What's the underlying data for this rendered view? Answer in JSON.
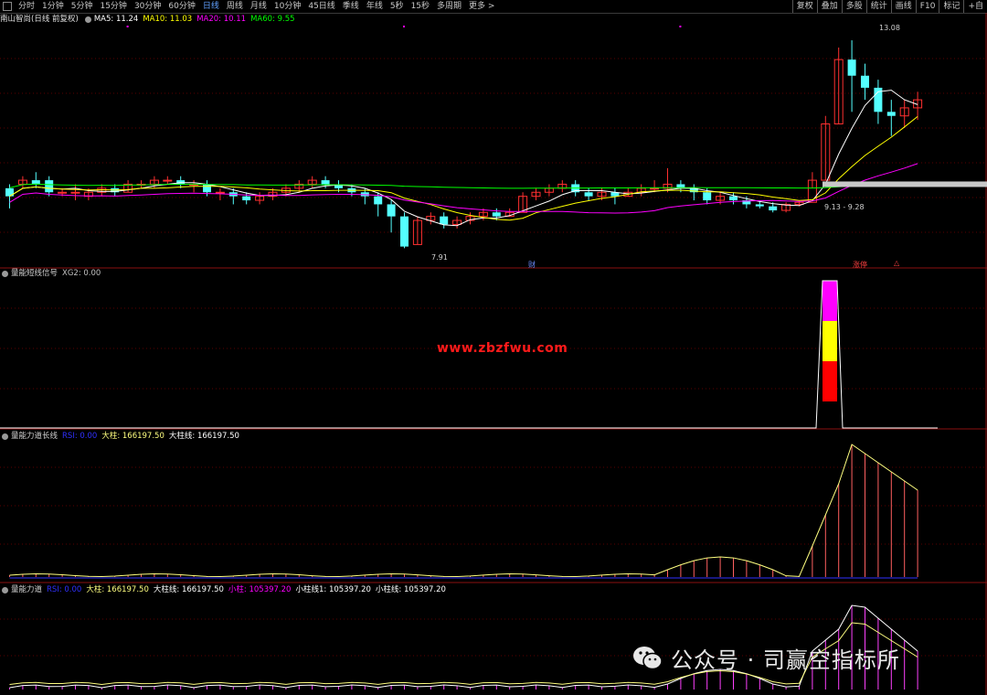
{
  "toolbar": {
    "tabs": [
      {
        "label": "分时"
      },
      {
        "label": "1分钟"
      },
      {
        "label": "5分钟"
      },
      {
        "label": "15分钟"
      },
      {
        "label": "30分钟"
      },
      {
        "label": "60分钟"
      },
      {
        "label": "日线",
        "active": true
      },
      {
        "label": "周线"
      },
      {
        "label": "月线"
      },
      {
        "label": "10分钟"
      },
      {
        "label": "45日线"
      },
      {
        "label": "季线"
      },
      {
        "label": "年线"
      },
      {
        "label": "5秒"
      },
      {
        "label": "15秒"
      },
      {
        "label": "多周期"
      },
      {
        "label": "更多 >"
      }
    ],
    "right_items": [
      {
        "label": "复权"
      },
      {
        "label": "叠加"
      },
      {
        "label": "多股"
      },
      {
        "label": "统计"
      },
      {
        "label": "画线"
      },
      {
        "label": "F10"
      },
      {
        "label": "标记"
      },
      {
        "label": "+自"
      }
    ]
  },
  "main_panel": {
    "stock_name": "南山智尚(日线 前复权)",
    "ma": [
      {
        "label": "MA5: 11.24",
        "color": "#ffffff"
      },
      {
        "label": "MA10: 11.03",
        "color": "#ffff00"
      },
      {
        "label": "MA20: 10.11",
        "color": "#ff00ff"
      },
      {
        "label": "MA60: 9.55",
        "color": "#00ff00"
      }
    ],
    "high_label": "13.08",
    "low_label": "7.91",
    "range_label": "9.13 - 9.28",
    "event_tags": [
      {
        "text": "财",
        "color": "#6b8cff"
      },
      {
        "text": "涨停",
        "color": "#ff4040"
      },
      {
        "text": "△",
        "color": "#ff4040"
      }
    ]
  },
  "panel2": {
    "title": "量能短线信号",
    "values": [
      {
        "label": "XG2: 0.00",
        "color": "#c0c0c0"
      }
    ]
  },
  "panel3": {
    "title": "量能力道长线",
    "values": [
      {
        "label": "RSI: 0.00",
        "color": "#3030ff"
      },
      {
        "label": "大柱: 166197.50",
        "color": "#ffff80"
      },
      {
        "label": "大柱线: 166197.50",
        "color": "#ffffff"
      }
    ]
  },
  "panel4": {
    "title": "量能力道",
    "values": [
      {
        "label": "RSI: 0.00",
        "color": "#3030ff"
      },
      {
        "label": "大柱: 166197.50",
        "color": "#ffff80"
      },
      {
        "label": "大柱线: 166197.50",
        "color": "#ffffff"
      },
      {
        "label": "小柱: 105397.20",
        "color": "#ff00ff"
      },
      {
        "label": "小柱线1: 105397.20",
        "color": "#ffffff"
      },
      {
        "label": "小柱线: 105397.20",
        "color": "#ffffff"
      }
    ]
  },
  "watermark": "www.zbzfwu.com",
  "wechat_caption": "公众号 · 司赢空指标所",
  "colors": {
    "up": "#ff3030",
    "down": "#54ffff",
    "grid": "#5a0000",
    "ma5": "#ffffff",
    "ma10": "#ffff00",
    "ma20": "#ff00ff",
    "ma60": "#00ff00"
  },
  "chart_data": {
    "type": "candlestick",
    "ylim": [
      7.6,
      13.4
    ],
    "candles": [
      [
        9.4,
        9.5,
        9.2,
        8.9
      ],
      [
        9.5,
        9.7,
        9.6,
        9.4
      ],
      [
        9.6,
        9.8,
        9.5,
        9.4
      ],
      [
        9.6,
        9.7,
        9.3,
        9.2
      ],
      [
        9.3,
        9.4,
        9.3,
        9.2
      ],
      [
        9.3,
        9.5,
        9.3,
        9.1
      ],
      [
        9.2,
        9.4,
        9.3,
        9.1
      ],
      [
        9.3,
        9.5,
        9.4,
        9.2
      ],
      [
        9.4,
        9.5,
        9.3,
        9.2
      ],
      [
        9.3,
        9.6,
        9.5,
        9.3
      ],
      [
        9.5,
        9.6,
        9.5,
        9.4
      ],
      [
        9.5,
        9.7,
        9.6,
        9.4
      ],
      [
        9.6,
        9.7,
        9.6,
        9.5
      ],
      [
        9.6,
        9.7,
        9.5,
        9.4
      ],
      [
        9.5,
        9.6,
        9.5,
        9.3
      ],
      [
        9.5,
        9.6,
        9.3,
        9.2
      ],
      [
        9.3,
        9.4,
        9.3,
        9.1
      ],
      [
        9.3,
        9.4,
        9.2,
        9.0
      ],
      [
        9.2,
        9.3,
        9.1,
        9.0
      ],
      [
        9.1,
        9.3,
        9.2,
        9.0
      ],
      [
        9.2,
        9.4,
        9.3,
        9.1
      ],
      [
        9.3,
        9.5,
        9.4,
        9.2
      ],
      [
        9.4,
        9.6,
        9.5,
        9.3
      ],
      [
        9.5,
        9.7,
        9.6,
        9.4
      ],
      [
        9.6,
        9.7,
        9.5,
        9.4
      ],
      [
        9.5,
        9.6,
        9.4,
        9.3
      ],
      [
        9.4,
        9.5,
        9.3,
        9.2
      ],
      [
        9.3,
        9.4,
        9.2,
        9.0
      ],
      [
        9.2,
        9.3,
        9.0,
        8.7
      ],
      [
        9.0,
        9.1,
        8.7,
        8.3
      ],
      [
        8.7,
        8.8,
        7.95,
        7.91
      ],
      [
        8.0,
        8.7,
        8.6,
        8.0
      ],
      [
        8.6,
        8.8,
        8.7,
        8.5
      ],
      [
        8.7,
        8.8,
        8.5,
        8.4
      ],
      [
        8.5,
        8.7,
        8.6,
        8.4
      ],
      [
        8.6,
        8.8,
        8.7,
        8.5
      ],
      [
        8.7,
        8.9,
        8.8,
        8.6
      ],
      [
        8.8,
        8.9,
        8.7,
        8.6
      ],
      [
        8.7,
        8.9,
        8.8,
        8.7
      ],
      [
        8.8,
        9.3,
        9.2,
        8.8
      ],
      [
        9.2,
        9.4,
        9.3,
        9.1
      ],
      [
        9.3,
        9.5,
        9.4,
        9.2
      ],
      [
        9.4,
        9.6,
        9.5,
        9.3
      ],
      [
        9.5,
        9.6,
        9.3,
        9.2
      ],
      [
        9.3,
        9.4,
        9.2,
        9.1
      ],
      [
        9.2,
        9.4,
        9.3,
        9.1
      ],
      [
        9.3,
        9.4,
        9.2,
        9.0
      ],
      [
        9.2,
        9.4,
        9.3,
        9.2
      ],
      [
        9.3,
        9.5,
        9.4,
        9.2
      ],
      [
        9.4,
        9.6,
        9.4,
        9.3
      ],
      [
        9.4,
        9.9,
        9.5,
        9.3
      ],
      [
        9.5,
        9.6,
        9.4,
        9.3
      ],
      [
        9.4,
        9.5,
        9.3,
        9.1
      ],
      [
        9.3,
        9.4,
        9.1,
        9.0
      ],
      [
        9.1,
        9.3,
        9.2,
        9.0
      ],
      [
        9.2,
        9.3,
        9.1,
        9.0
      ],
      [
        9.1,
        9.2,
        9.0,
        8.9
      ],
      [
        9.0,
        9.1,
        8.95,
        8.9
      ],
      [
        8.95,
        9.05,
        8.85,
        8.8
      ],
      [
        8.85,
        9.05,
        9.0,
        8.8
      ],
      [
        9.0,
        9.1,
        9.05,
        8.95
      ],
      [
        9.05,
        9.8,
        9.6,
        9.4
      ],
      [
        9.6,
        11.2,
        11.0,
        9.6
      ],
      [
        11.0,
        12.9,
        12.6,
        11.0
      ],
      [
        12.6,
        13.08,
        12.2,
        11.3
      ],
      [
        12.2,
        12.5,
        11.9,
        11.6
      ],
      [
        11.9,
        12.1,
        11.3,
        11.0
      ],
      [
        11.3,
        11.6,
        11.2,
        10.7
      ],
      [
        11.2,
        11.6,
        11.4,
        10.9
      ],
      [
        11.4,
        11.8,
        11.6,
        11.1
      ]
    ],
    "ma60_last": 9.55,
    "panel2_bar": {
      "segments": [
        "#ff00ff",
        "#ffff00",
        "#ff0000"
      ]
    }
  }
}
